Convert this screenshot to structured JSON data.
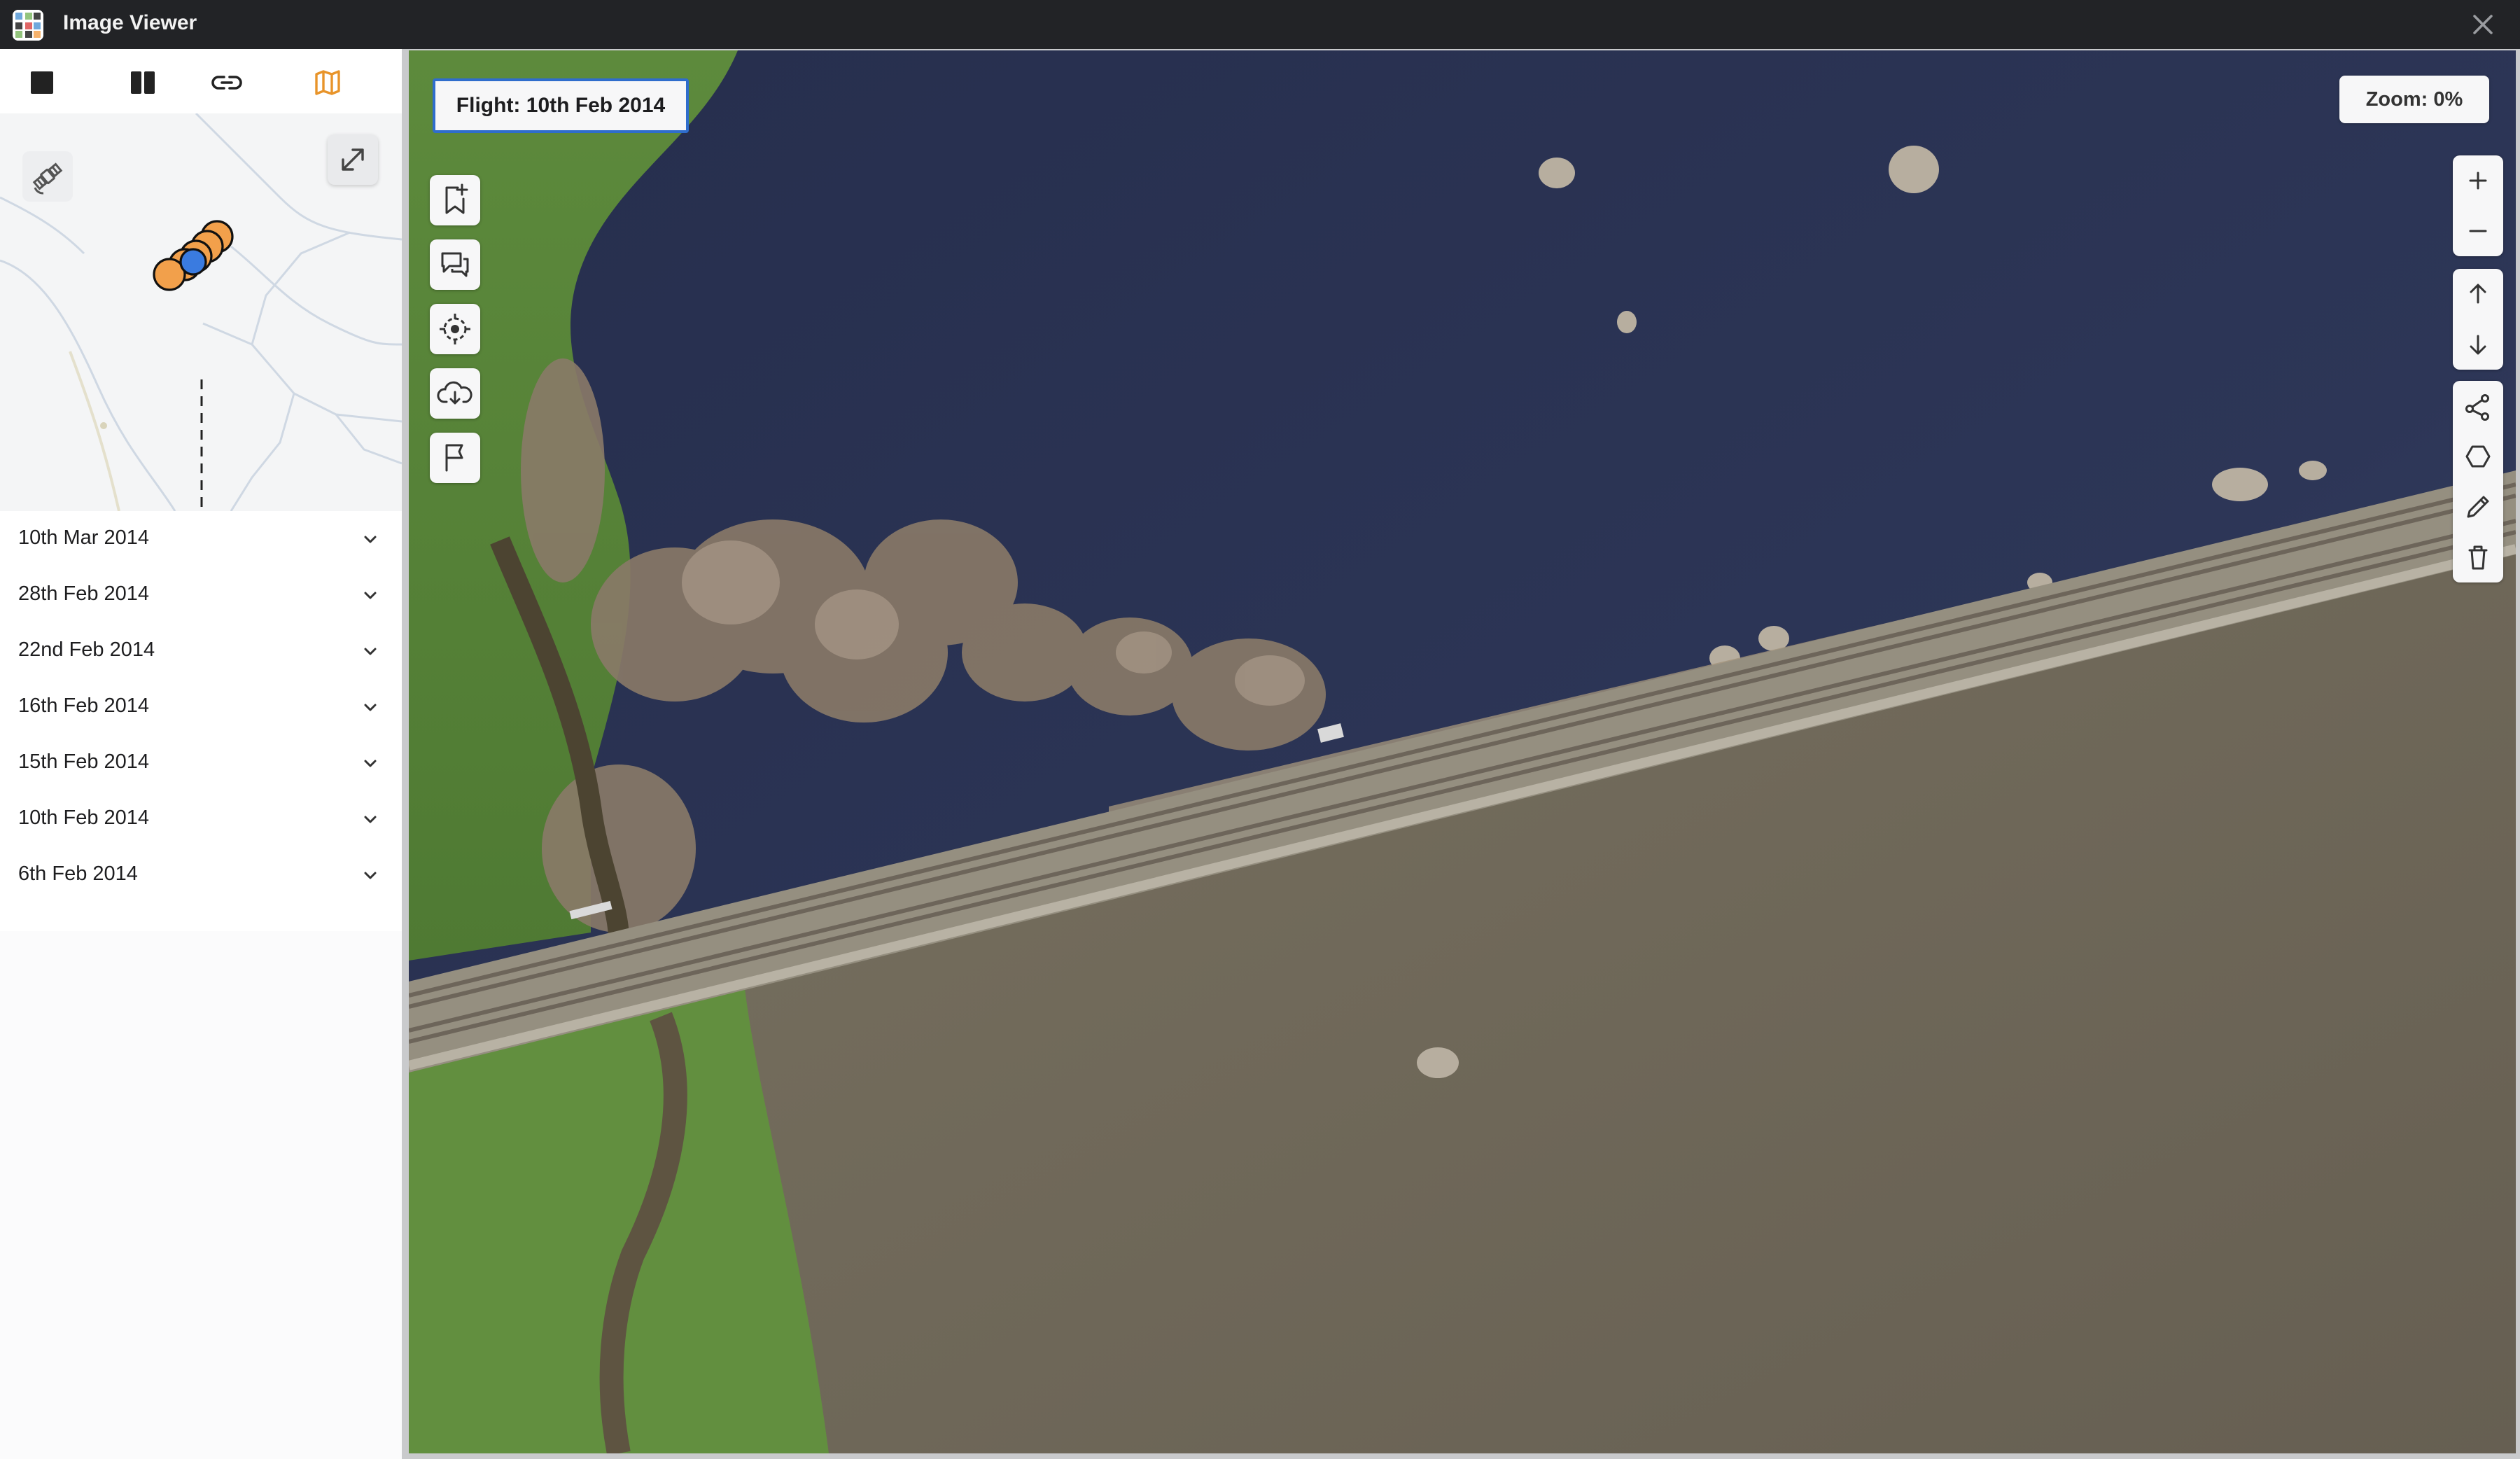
{
  "window": {
    "title": "Image Viewer",
    "icons": {
      "app": "image-viewer-app-icon",
      "close": "close-icon"
    }
  },
  "view_toolbar": {
    "items": [
      {
        "name": "single-view-icon",
        "active": false
      },
      {
        "name": "split-view-icon",
        "active": false
      },
      {
        "name": "link-icon",
        "active": false
      },
      {
        "name": "map-icon",
        "active": true
      }
    ],
    "accent_color": "#e8942a"
  },
  "minimap": {
    "buttons": [
      "satellite-icon",
      "expand-icon"
    ],
    "marker_colors": {
      "other_flights": "#f2a04b",
      "current_flight": "#3a7be0"
    }
  },
  "flights": {
    "items": [
      {
        "label": "10th Mar 2014"
      },
      {
        "label": "28th Feb 2014"
      },
      {
        "label": "22nd Feb 2014"
      },
      {
        "label": "16th Feb 2014"
      },
      {
        "label": "15th Feb 2014"
      },
      {
        "label": "10th Feb 2014"
      },
      {
        "label": "6th Feb 2014"
      }
    ]
  },
  "viewer": {
    "flight_label": "Flight: 10th Feb 2014",
    "zoom_label": "Zoom: 0%",
    "left_tools": [
      "bookmark-add-icon",
      "comments-icon",
      "locate-icon",
      "cloud-download-icon",
      "flag-icon"
    ],
    "right_tools": [
      [
        "zoom-in-icon",
        "zoom-out-icon"
      ],
      [
        "arrow-up-icon",
        "arrow-down-icon"
      ],
      [
        "polyline-icon",
        "polygon-icon",
        "pencil-icon",
        "trash-icon"
      ]
    ],
    "accent_color": "#2f6dcc"
  }
}
